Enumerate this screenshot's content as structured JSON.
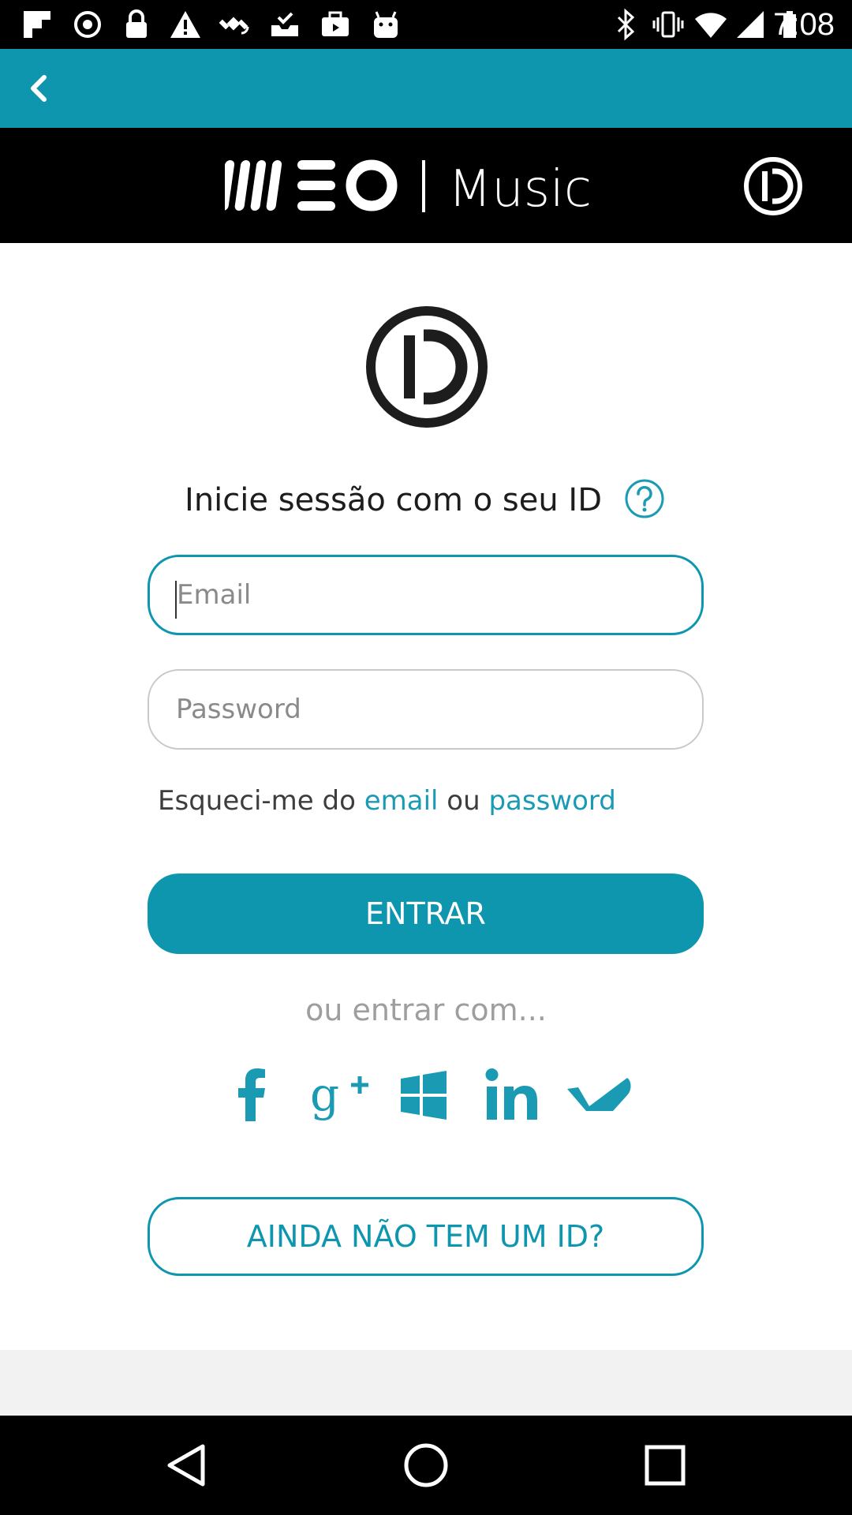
{
  "status_bar": {
    "time": "7:08",
    "left_icons": [
      "flipboard-icon",
      "radio-icon",
      "lock-icon",
      "warning-icon",
      "satellite-icon",
      "inbox-check-icon",
      "briefcase-icon",
      "android-icon"
    ],
    "right_icons": [
      "bluetooth-icon",
      "vibrate-icon",
      "wifi-icon",
      "signal-icon",
      "battery-icon"
    ]
  },
  "app_bar": {
    "back_icon": "chevron-left-icon",
    "color": "#0d96ad"
  },
  "header": {
    "logo_text": "MEO | Music",
    "id_icon": "id-logo-icon"
  },
  "login": {
    "id_logo": "id-logo-icon",
    "title": "Inicie sessão com o seu ID",
    "help_icon": "question-circle-icon",
    "email_placeholder": "Email",
    "password_placeholder": "Password",
    "forgot_prefix": "Esqueci-me do",
    "forgot_email": "email",
    "forgot_or": "ou",
    "forgot_password": "password",
    "submit_label": "ENTRAR",
    "or_enter_with": "ou entrar com...",
    "social": [
      "facebook-icon",
      "google-plus-icon",
      "windows-icon",
      "linkedin-icon",
      "sapo-icon"
    ],
    "signup_label": "AINDA NÃO TEM UM ID?"
  },
  "colors": {
    "accent": "#0d96ad",
    "link": "#1a9bb3",
    "header_bg": "#000000"
  },
  "nav_bar": {
    "back_icon": "nav-back-icon",
    "home_icon": "nav-home-icon",
    "recents_icon": "nav-recents-icon"
  }
}
